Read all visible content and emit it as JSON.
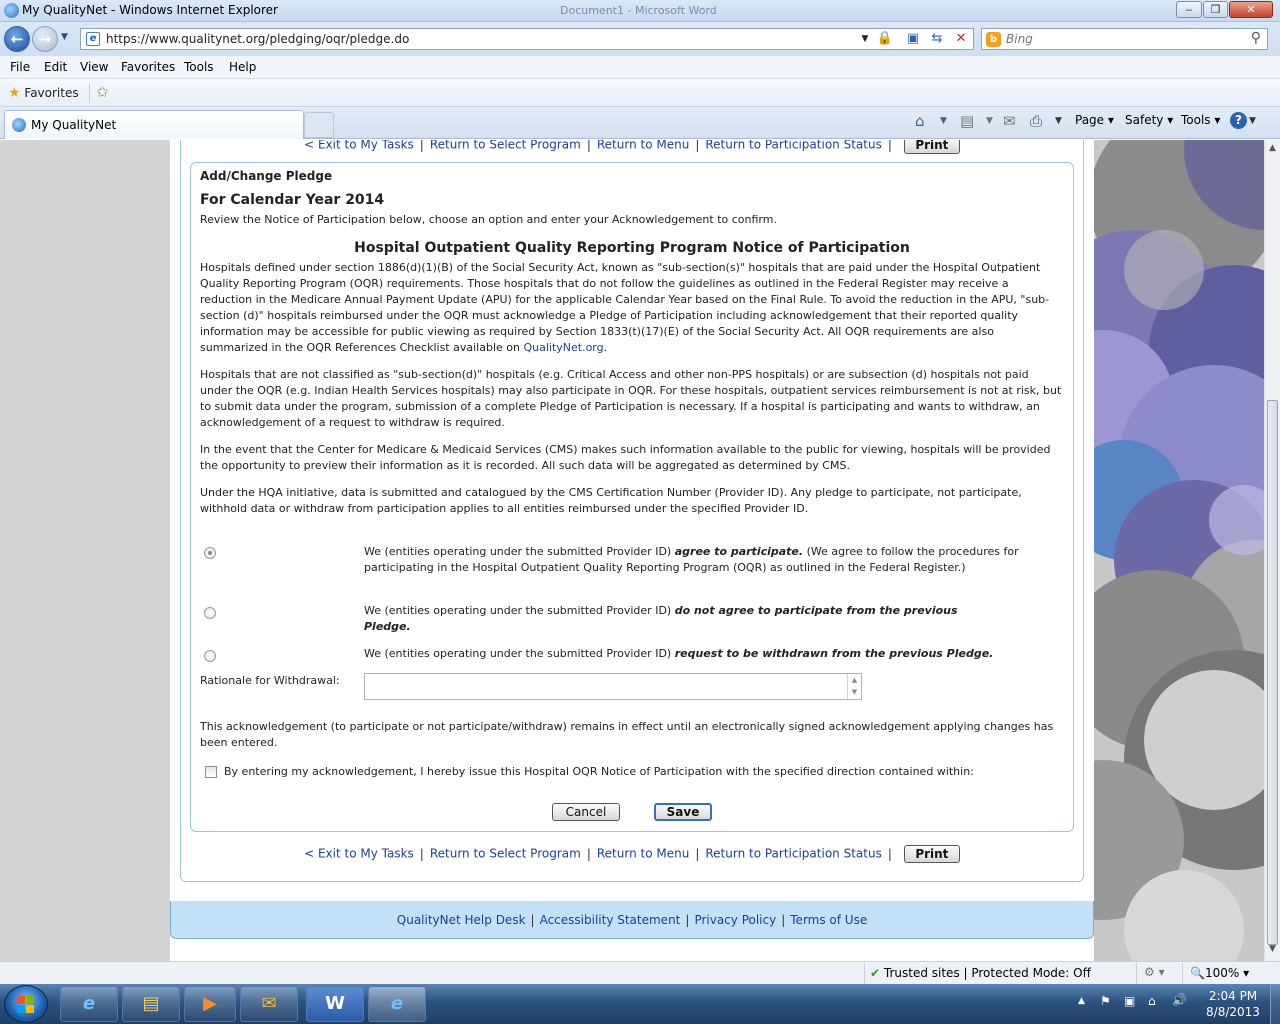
{
  "window": {
    "title": "My QualityNet - Windows Internet Explorer",
    "background_task_title": "Document1 - Microsoft Word"
  },
  "address": {
    "url": "https://www.qualitynet.org/pledging/oqr/pledge.do"
  },
  "search": {
    "placeholder": "Bing"
  },
  "menu": [
    "File",
    "Edit",
    "View",
    "Favorites",
    "Tools",
    "Help"
  ],
  "favorites": {
    "label": "Favorites"
  },
  "tabs": [
    {
      "label": "My QualityNet"
    }
  ],
  "command_bar": {
    "page": "Page",
    "safety": "Safety",
    "tools": "Tools"
  },
  "nav_links": {
    "exit": "< Exit to My Tasks",
    "select_program": "Return to Select Program",
    "menu": "Return to Menu",
    "participation_status": "Return to Participation Status",
    "print": "Print"
  },
  "form": {
    "section_title": "Add/Change Pledge",
    "year_title": "For Calendar Year 2014",
    "intro": "Review the Notice of Participation below, choose an option and enter your Acknowledgement to confirm.",
    "notice_title": "Hospital Outpatient Quality Reporting Program Notice of Participation",
    "para1": "Hospitals defined under section 1886(d)(1)(B) of the Social Security Act, known as \"sub-section(s)\" hospitals that are paid under the Hospital Outpatient Quality Reporting Program (OQR) requirements. Those hospitals that do not follow the guidelines as outlined in the Federal Register may receive a reduction in the Medicare Annual Payment Update (APU) for the applicable Calendar Year based on the Final Rule. To avoid the reduction in the APU, \"sub-section (d)\" hospitals reimbursed under the OQR must acknowledge a Pledge of Participation including acknowledgement that their reported quality information may be accessible for public viewing as required by Section 1833(t)(17)(E) of the Social Security Act. All OQR requirements are also summarized in the OQR References Checklist available on",
    "para1_link": "QualityNet.org",
    "para1_end": ".",
    "para2": "Hospitals that are not classified as \"sub-section(d)\" hospitals (e.g. Critical Access and other non-PPS hospitals) or are subsection (d) hospitals not paid under the OQR (e.g. Indian Health Services hospitals) may also participate in OQR. For these hospitals, outpatient services reimbursement is not at risk, but to submit data under the program, submission of a complete Pledge of Participation is necessary. If a hospital is participating and wants to withdraw, an acknowledgement of a request to withdraw is required.",
    "para3": "In the event that the Center for Medicare & Medicaid Services (CMS) makes such information available to the public for viewing, hospitals will be provided the opportunity to preview their information as it is recorded. All such data will be aggregated as determined by CMS.",
    "para4": "Under the HQA initiative, data is submitted and catalogued by the CMS Certification Number (Provider ID). Any pledge to participate, not participate, withhold data or withdraw from participation applies to all entities reimbursed under the specified Provider ID.",
    "option_prefix": "We (entities operating under the submitted Provider ID)",
    "option1_em": "agree to participate.",
    "option1_rest": "(We agree to follow the procedures for participating in the Hospital Outpatient Quality Reporting Program (OQR) as outlined in the Federal Register.)",
    "option2_em": "do not agree to participate from the previous Pledge.",
    "option3_em": "request to be withdrawn from the previous Pledge.",
    "rationale_label": "Rationale for Withdrawal:",
    "rationale_value": "",
    "ack_note": "This acknowledgement (to participate or not participate/withdraw) remains in effect until an electronically signed acknowledgement applying changes has been entered.",
    "ack_checkbox": "By entering my acknowledgement, I hereby issue this Hospital OQR Notice of Participation with the specified direction contained within:",
    "cancel": "Cancel",
    "save": "Save"
  },
  "footer": {
    "help": "QualityNet Help Desk",
    "accessibility": "Accessibility Statement",
    "privacy": "Privacy Policy",
    "terms": "Terms of Use"
  },
  "statusbar": {
    "zone": "Trusted sites | Protected Mode: Off",
    "zoom": "100%"
  },
  "taskbar": {
    "time": "2:04 PM",
    "date": "8/8/2013"
  },
  "colors": {
    "link": "#1a3f9a",
    "box_border": "#9cc4e4",
    "footer_bg": "#c2e1f7"
  }
}
